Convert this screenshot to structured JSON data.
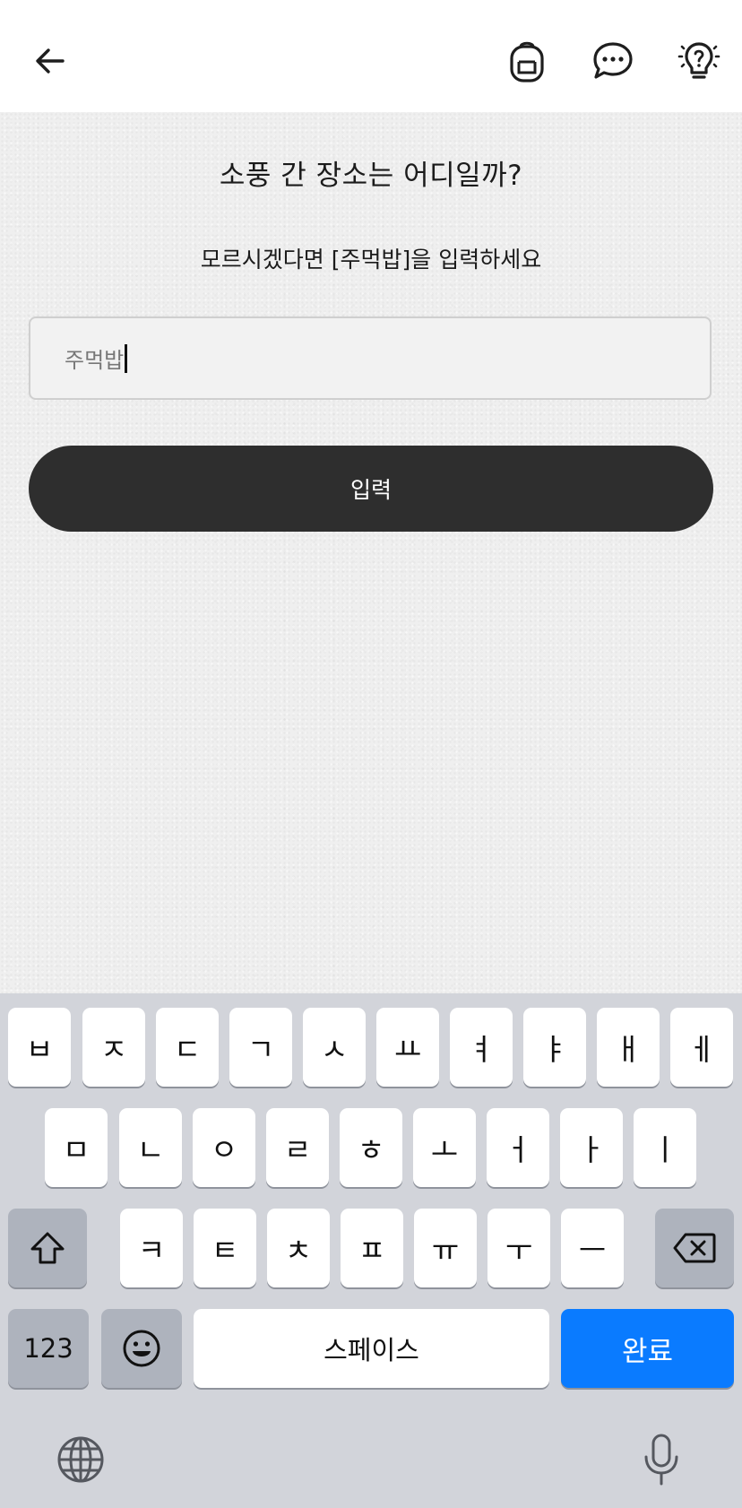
{
  "header": {
    "icons": [
      "arrow-left-icon",
      "backpack-icon",
      "chat-bubble-icon",
      "lightbulb-question-icon"
    ]
  },
  "quiz": {
    "question": "소풍 간 장소는 어디일까?",
    "hint": "모르시겠다면 [주먹밥]을 입력하세요",
    "answer_value": "주먹밥",
    "submit_label": "입력"
  },
  "keyboard": {
    "row1": [
      "ㅂ",
      "ㅈ",
      "ㄷ",
      "ㄱ",
      "ㅅ",
      "ㅛ",
      "ㅕ",
      "ㅑ",
      "ㅐ",
      "ㅔ"
    ],
    "row2": [
      "ㅁ",
      "ㄴ",
      "ㅇ",
      "ㄹ",
      "ㅎ",
      "ㅗ",
      "ㅓ",
      "ㅏ",
      "ㅣ"
    ],
    "row3": [
      "ㅋ",
      "ㅌ",
      "ㅊ",
      "ㅍ",
      "ㅠ",
      "ㅜ",
      "ㅡ"
    ],
    "numbers_label": "123",
    "space_label": "스페이스",
    "done_label": "완료",
    "accent_color": "#0a7bff"
  }
}
